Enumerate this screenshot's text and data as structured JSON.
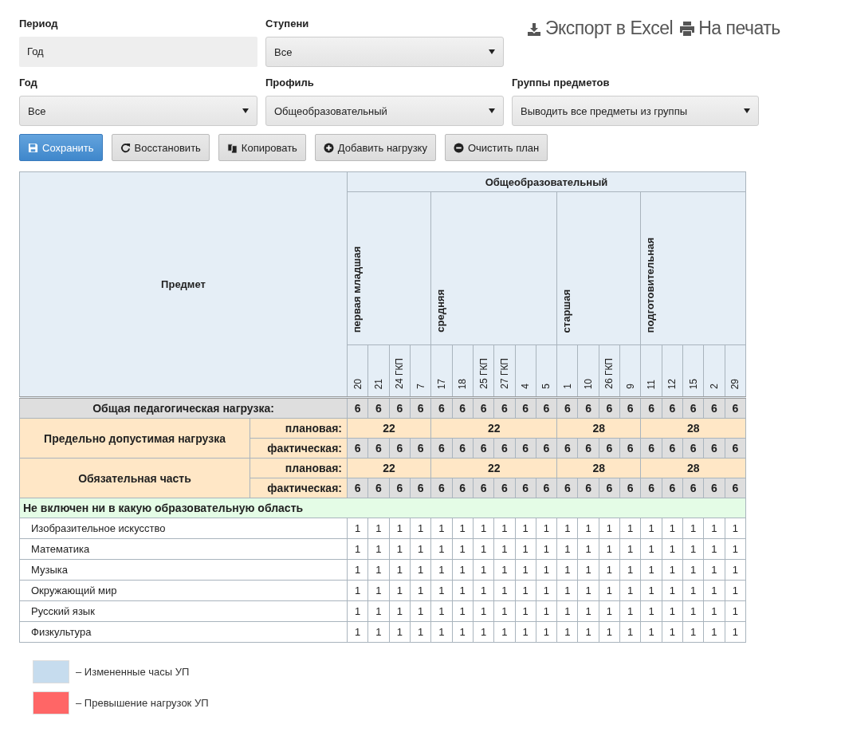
{
  "filters": {
    "period": {
      "label": "Период",
      "value": "Год"
    },
    "steps": {
      "label": "Ступени",
      "value": "Все"
    },
    "year": {
      "label": "Год",
      "value": "Все"
    },
    "profile": {
      "label": "Профиль",
      "value": "Общеобразовательный"
    },
    "groups": {
      "label": "Группы предметов",
      "value": "Выводить все предметы из группы"
    }
  },
  "links": [
    {
      "kind": "export",
      "label": "Экспорт в Excel"
    },
    {
      "kind": "print",
      "label": "На печать"
    }
  ],
  "buttons": [
    {
      "kind": "save",
      "label": "Сохранить"
    },
    {
      "kind": "restore",
      "label": "Восстановить"
    },
    {
      "kind": "copy",
      "label": "Копировать"
    },
    {
      "kind": "add",
      "label": "Добавить нагрузку"
    },
    {
      "kind": "clear",
      "label": "Очистить план"
    }
  ],
  "table": {
    "subject_header": "Предмет",
    "profile": "Общеобразовательный",
    "groups": [
      {
        "name": "первая младшая",
        "classes": [
          "20",
          "21",
          "24 ГКП",
          "7"
        ]
      },
      {
        "name": "средняя",
        "classes": [
          "17",
          "18",
          "25 ГКП",
          "27 ГКП",
          "4",
          "5"
        ]
      },
      {
        "name": "старшая",
        "classes": [
          "1",
          "10",
          "26 ГКП",
          "9"
        ]
      },
      {
        "name": "подготовительная",
        "classes": [
          "11",
          "12",
          "15",
          "2",
          "29"
        ]
      }
    ],
    "total": {
      "label": "Общая педагогическая нагрузка:",
      "values": [
        "6",
        "6",
        "6",
        "6",
        "6",
        "6",
        "6",
        "6",
        "6",
        "6",
        "6",
        "6",
        "6",
        "6",
        "6",
        "6",
        "6",
        "6",
        "6"
      ]
    },
    "limits": [
      {
        "label": "Предельно допустимая нагрузка",
        "planned_label": "плановая:",
        "planned": [
          "22",
          "22",
          "28",
          "28"
        ],
        "actual_label": "фактическая:",
        "actual": [
          "6",
          "6",
          "6",
          "6",
          "6",
          "6",
          "6",
          "6",
          "6",
          "6",
          "6",
          "6",
          "6",
          "6",
          "6",
          "6",
          "6",
          "6",
          "6"
        ]
      },
      {
        "label": "Обязательная часть",
        "planned_label": "плановая:",
        "planned": [
          "22",
          "22",
          "28",
          "28"
        ],
        "actual_label": "фактическая:",
        "actual": [
          "6",
          "6",
          "6",
          "6",
          "6",
          "6",
          "6",
          "6",
          "6",
          "6",
          "6",
          "6",
          "6",
          "6",
          "6",
          "6",
          "6",
          "6",
          "6"
        ]
      }
    ],
    "sections": [
      {
        "title": "Не включен ни в какую образовательную область",
        "rows": [
          {
            "subject": "Изобразительное искусство",
            "values": [
              "1",
              "1",
              "1",
              "1",
              "1",
              "1",
              "1",
              "1",
              "1",
              "1",
              "1",
              "1",
              "1",
              "1",
              "1",
              "1",
              "1",
              "1",
              "1"
            ]
          },
          {
            "subject": "Математика",
            "values": [
              "1",
              "1",
              "1",
              "1",
              "1",
              "1",
              "1",
              "1",
              "1",
              "1",
              "1",
              "1",
              "1",
              "1",
              "1",
              "1",
              "1",
              "1",
              "1"
            ]
          },
          {
            "subject": "Музыка",
            "values": [
              "1",
              "1",
              "1",
              "1",
              "1",
              "1",
              "1",
              "1",
              "1",
              "1",
              "1",
              "1",
              "1",
              "1",
              "1",
              "1",
              "1",
              "1",
              "1"
            ]
          },
          {
            "subject": "Окружающий мир",
            "values": [
              "1",
              "1",
              "1",
              "1",
              "1",
              "1",
              "1",
              "1",
              "1",
              "1",
              "1",
              "1",
              "1",
              "1",
              "1",
              "1",
              "1",
              "1",
              "1"
            ]
          },
          {
            "subject": "Русский язык",
            "values": [
              "1",
              "1",
              "1",
              "1",
              "1",
              "1",
              "1",
              "1",
              "1",
              "1",
              "1",
              "1",
              "1",
              "1",
              "1",
              "1",
              "1",
              "1",
              "1"
            ]
          },
          {
            "subject": "Физкультура",
            "values": [
              "1",
              "1",
              "1",
              "1",
              "1",
              "1",
              "1",
              "1",
              "1",
              "1",
              "1",
              "1",
              "1",
              "1",
              "1",
              "1",
              "1",
              "1",
              "1"
            ]
          }
        ]
      }
    ]
  },
  "legend": [
    {
      "color": "#c6dcee",
      "label": "– Измененные часы УП"
    },
    {
      "color": "#ff6666",
      "label": "– Превышение нагрузок УП"
    }
  ]
}
